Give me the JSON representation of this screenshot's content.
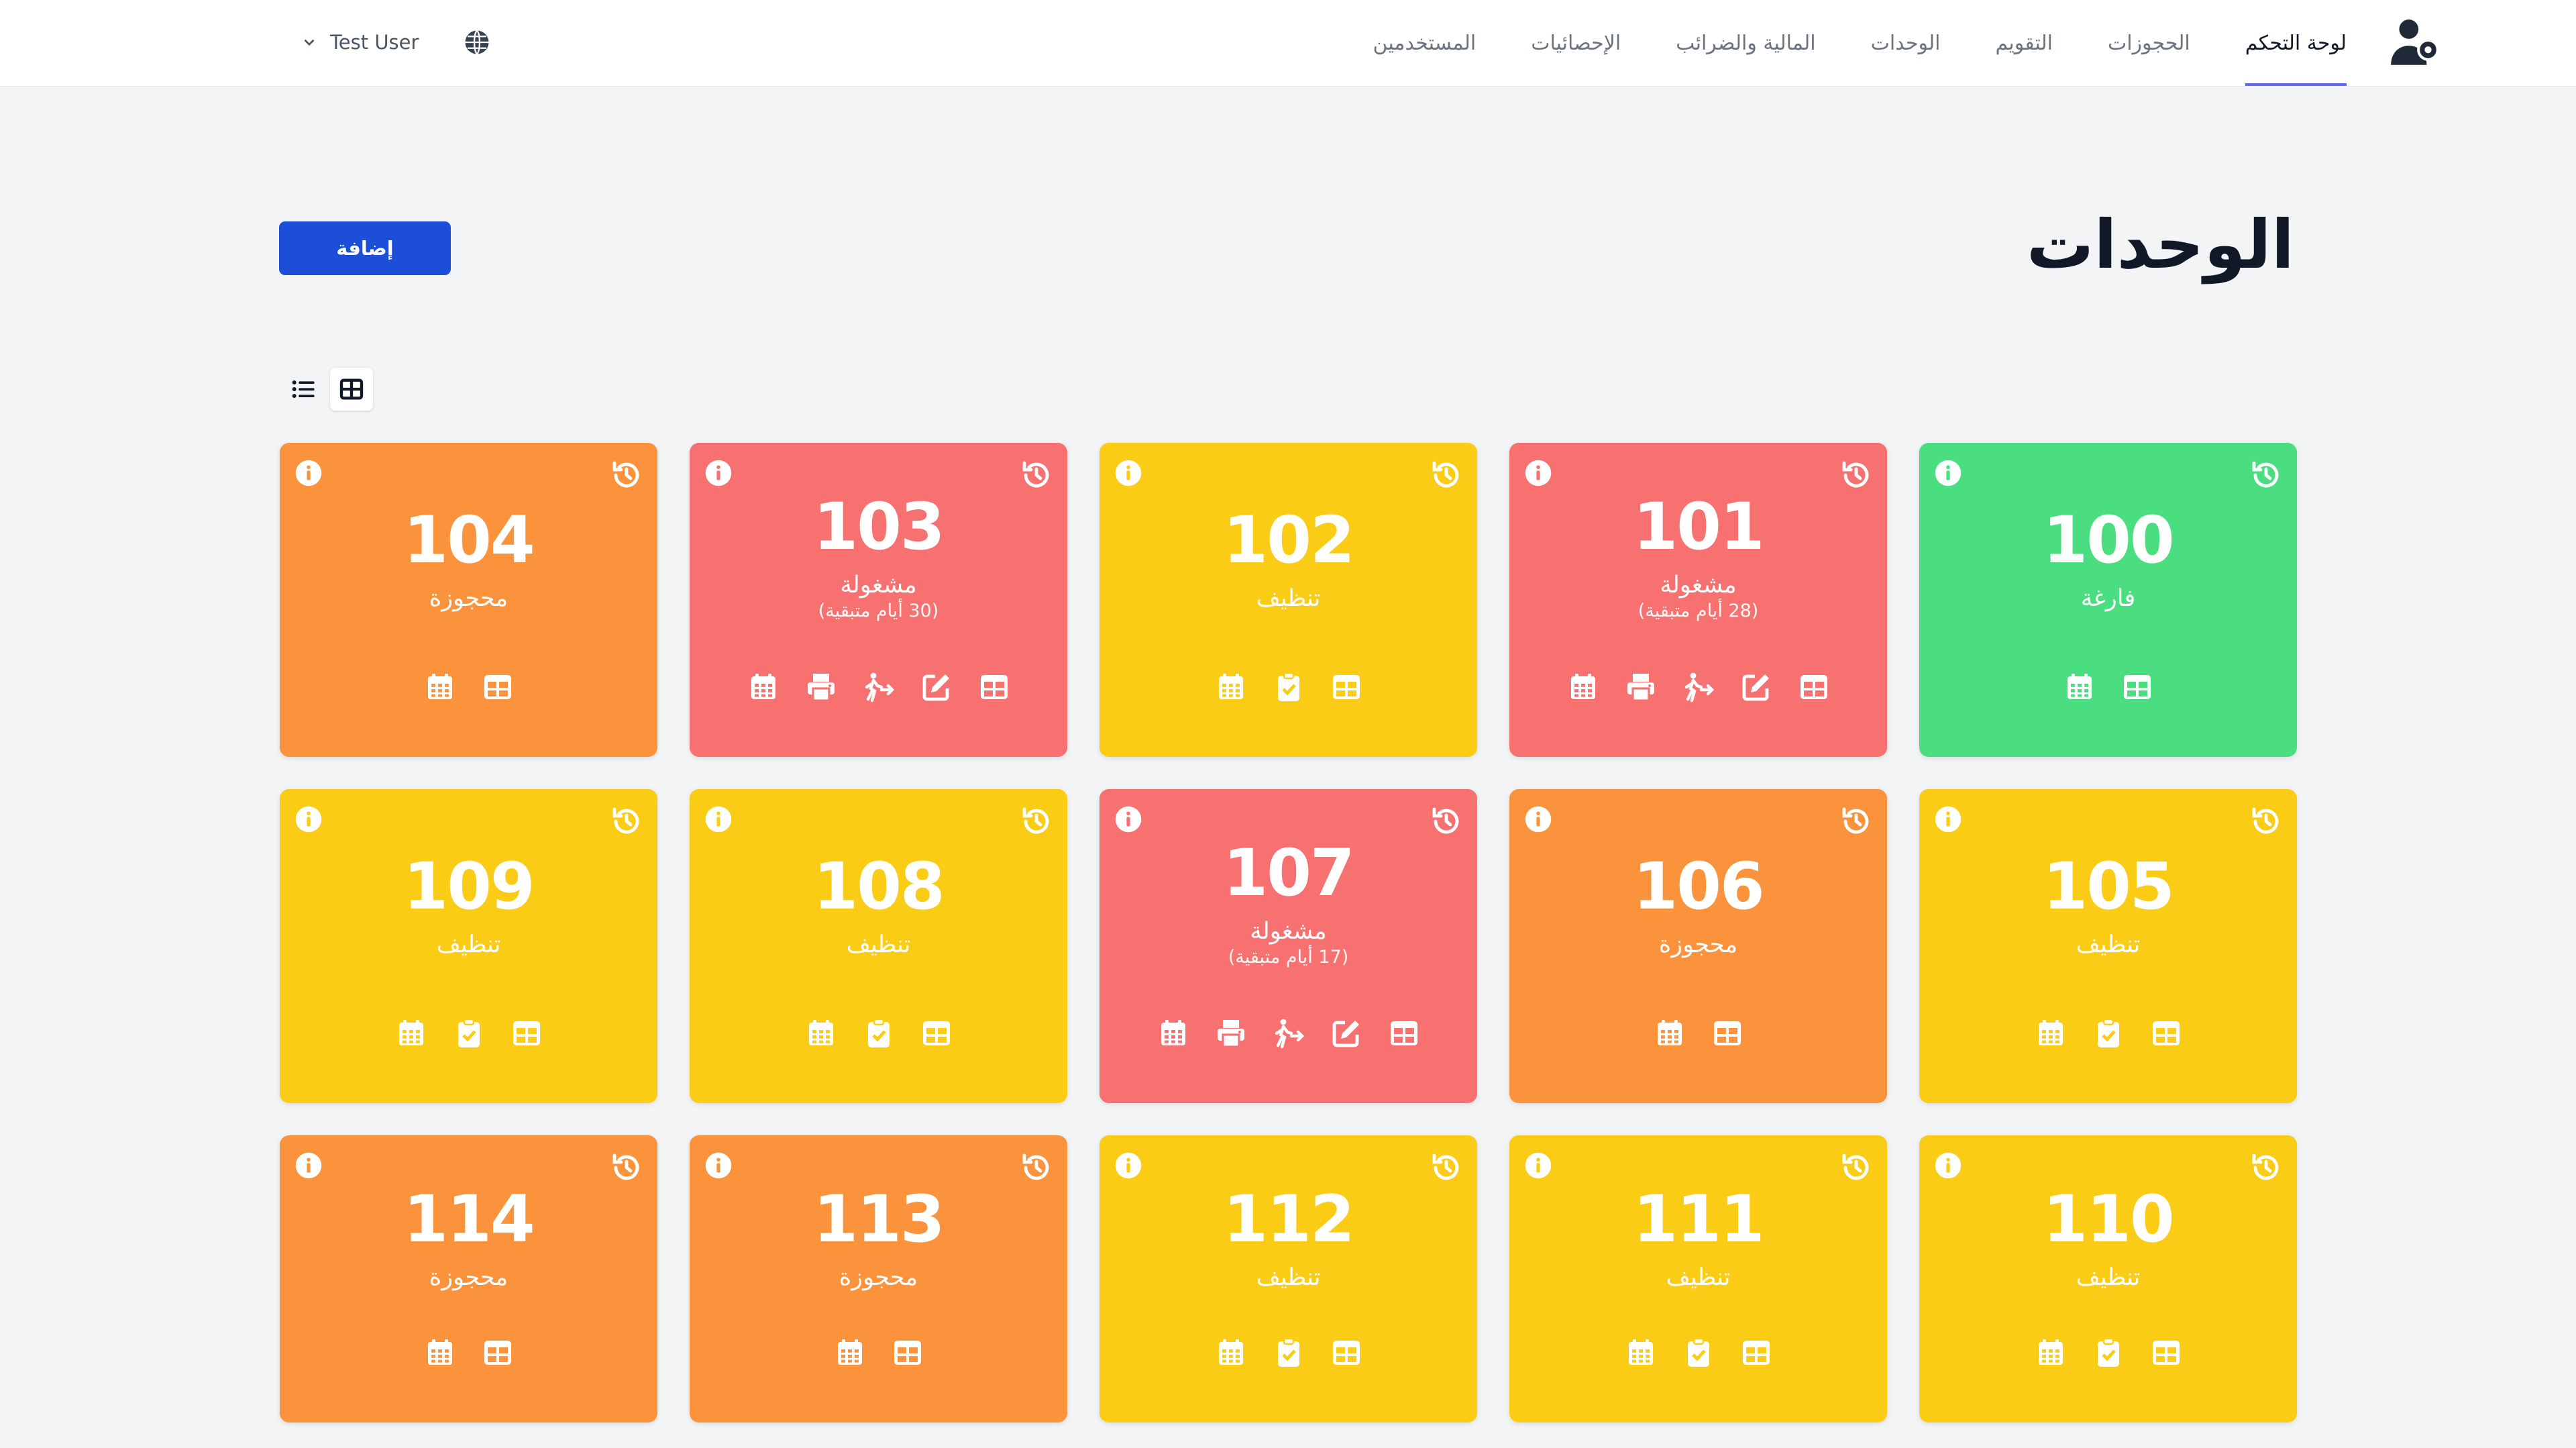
{
  "header": {
    "user_name": "Test User",
    "nav": [
      "لوحة التحكم",
      "الحجوزات",
      "التقويم",
      "الوحدات",
      "المالية والضرائب",
      "الإحصائيات",
      "المستخدمين"
    ],
    "active_index": 0
  },
  "page": {
    "title": "الوحدات",
    "add_label": "إضافة"
  },
  "colors": {
    "vacant": "#4ade80",
    "occupied": "#f87171",
    "cleaning": "#facc15",
    "reserved": "#fb923c",
    "accent": "#1d4ed8"
  },
  "units": [
    {
      "number": "100",
      "state": "vacant",
      "status": "فارغة",
      "days": "",
      "actions": [
        "calendar",
        "table"
      ]
    },
    {
      "number": "101",
      "state": "occupied",
      "status": "مشغولة",
      "days": "(28 أيام متبقية)",
      "actions": [
        "calendar",
        "printer",
        "checkout",
        "edit",
        "table"
      ]
    },
    {
      "number": "102",
      "state": "cleaning",
      "status": "تنظيف",
      "days": "",
      "actions": [
        "calendar",
        "clipboard-check",
        "table"
      ]
    },
    {
      "number": "103",
      "state": "occupied",
      "status": "مشغولة",
      "days": "(30 أيام متبقية)",
      "actions": [
        "calendar",
        "printer",
        "checkout",
        "edit",
        "table"
      ]
    },
    {
      "number": "104",
      "state": "reserved",
      "status": "محجوزة",
      "days": "",
      "actions": [
        "calendar",
        "table"
      ]
    },
    {
      "number": "105",
      "state": "cleaning",
      "status": "تنظيف",
      "days": "",
      "actions": [
        "calendar",
        "clipboard-check",
        "table"
      ]
    },
    {
      "number": "106",
      "state": "reserved",
      "status": "محجوزة",
      "days": "",
      "actions": [
        "calendar",
        "table"
      ]
    },
    {
      "number": "107",
      "state": "occupied",
      "status": "مشغولة",
      "days": "(17 أيام متبقية)",
      "actions": [
        "calendar",
        "printer",
        "checkout",
        "edit",
        "table"
      ]
    },
    {
      "number": "108",
      "state": "cleaning",
      "status": "تنظيف",
      "days": "",
      "actions": [
        "calendar",
        "clipboard-check",
        "table"
      ]
    },
    {
      "number": "109",
      "state": "cleaning",
      "status": "تنظيف",
      "days": "",
      "actions": [
        "calendar",
        "clipboard-check",
        "table"
      ]
    },
    {
      "number": "110",
      "state": "cleaning",
      "status": "تنظيف",
      "days": "",
      "actions": [
        "calendar",
        "clipboard-check",
        "table"
      ]
    },
    {
      "number": "111",
      "state": "cleaning",
      "status": "تنظيف",
      "days": "",
      "actions": [
        "calendar",
        "clipboard-check",
        "table"
      ]
    },
    {
      "number": "112",
      "state": "cleaning",
      "status": "تنظيف",
      "days": "",
      "actions": [
        "calendar",
        "clipboard-check",
        "table"
      ]
    },
    {
      "number": "113",
      "state": "reserved",
      "status": "محجوزة",
      "days": "",
      "actions": [
        "calendar",
        "table"
      ]
    },
    {
      "number": "114",
      "state": "reserved",
      "status": "محجوزة",
      "days": "",
      "actions": [
        "calendar",
        "table"
      ]
    }
  ]
}
